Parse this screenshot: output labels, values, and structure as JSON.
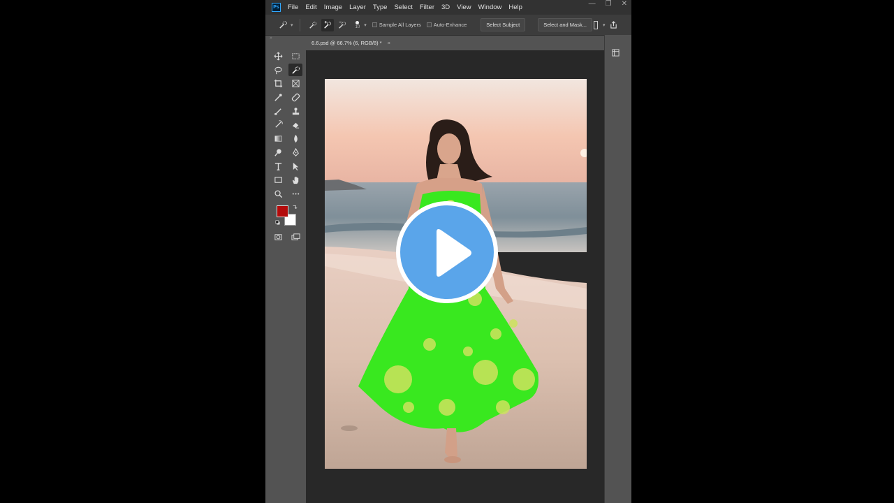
{
  "app": {
    "logo_text": "Ps",
    "menu": [
      "File",
      "Edit",
      "Image",
      "Layer",
      "Type",
      "Select",
      "Filter",
      "3D",
      "View",
      "Window",
      "Help"
    ],
    "window_controls": {
      "minimize": "—",
      "restore": "❐",
      "close": "✕"
    }
  },
  "options_bar": {
    "brush_size": "10",
    "sample_all_layers": {
      "label": "Sample All Layers",
      "checked": false
    },
    "auto_enhance": {
      "label": "Auto-Enhance",
      "checked": false
    },
    "select_subject_label": "Select Subject",
    "select_and_mask_label": "Select and Mask..."
  },
  "document_tab": {
    "title": "6.6.psd @ 66.7% (6, RGB/8) *",
    "close": "×"
  },
  "tools": [
    "move-tool",
    "marquee-tool",
    "lasso-tool",
    "quick-selection-tool",
    "crop-tool",
    "frame-tool",
    "eyedropper-tool",
    "healing-brush-tool",
    "brush-tool",
    "clone-stamp-tool",
    "history-brush-tool",
    "eraser-tool",
    "gradient-tool",
    "blur-tool",
    "dodge-tool",
    "pen-tool",
    "type-tool",
    "path-selection-tool",
    "rectangle-tool",
    "hand-tool",
    "zoom-tool",
    "more-tools"
  ],
  "colors": {
    "foreground": "#b30b0b",
    "background": "#ffffff",
    "dress_overlay": "#39e81f",
    "play_button": "#5aa5ea"
  },
  "overlay": {
    "icon": "play-icon"
  }
}
